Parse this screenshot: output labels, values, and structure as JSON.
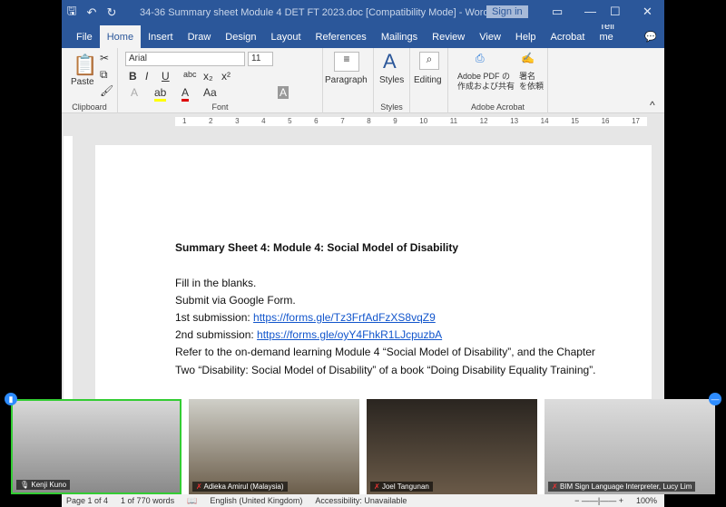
{
  "window": {
    "title": "34-36 Summary sheet Module 4 DET FT 2023.doc [Compatibility Mode]  -  Word",
    "sign_in": "Sign in"
  },
  "tabs": [
    "File",
    "Home",
    "Insert",
    "Draw",
    "Design",
    "Layout",
    "References",
    "Mailings",
    "Review",
    "View",
    "Help",
    "Acrobat",
    "Tell me"
  ],
  "ribbon": {
    "paste": "Paste",
    "clipboard": "Clipboard",
    "font_name": "Arial",
    "font_size": "11",
    "font": "Font",
    "paragraph": "Paragraph",
    "styles_btn": "Styles",
    "styles": "Styles",
    "editing": "Editing",
    "adobe_pdf": "Adobe PDF の\n作成および共有",
    "sign": "署名\nを依頼",
    "adobe_acrobat": "Adobe Acrobat"
  },
  "ruler": [
    "1",
    "2",
    "3",
    "4",
    "5",
    "6",
    "7",
    "8",
    "9",
    "10",
    "11",
    "12",
    "13",
    "14",
    "15",
    "16",
    "17"
  ],
  "document": {
    "heading": "Summary Sheet 4: Module 4: Social Model of Disability",
    "line1": "Fill in the blanks.",
    "line2": "Submit via Google Form.",
    "sub1_label": "1st submission: ",
    "sub1_link": "https://forms.gle/Tz3FrfAdFzXS8vqZ9",
    "sub2_label": "2nd submission: ",
    "sub2_link": "https://forms.gle/oyY4FhkR1LJcpuzbA",
    "line5": "Refer to the on-demand learning Module 4 “Social Model of Disability”, and the Chapter",
    "line6": "Two “Disability: Social Model of Disability” of a book “Doing Disability Equality Training”."
  },
  "status": {
    "page": "Page 1 of 4",
    "words": "1 of 770 words",
    "language": "English (United Kingdom)",
    "accessibility": "Accessibility: Unavailable",
    "zoom": "100%"
  },
  "participants": [
    {
      "name": "Kenji Kuno",
      "muted": false,
      "active": true
    },
    {
      "name": "Adieka Amirul (Malaysia)",
      "muted": true
    },
    {
      "name": "Joel Tangunan",
      "muted": true
    },
    {
      "name": "BIM Sign Language Interpreter, Lucy Lim",
      "muted": true
    }
  ]
}
